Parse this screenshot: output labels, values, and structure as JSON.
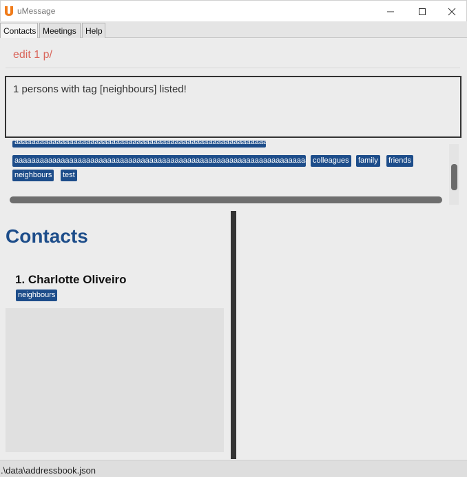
{
  "window": {
    "title": "uMessage",
    "icon": "umessage-logo-icon",
    "accent": "#f07b1a"
  },
  "menu": {
    "items": [
      {
        "label": "Contacts"
      },
      {
        "label": "Meetings"
      },
      {
        "label": "Help"
      }
    ]
  },
  "command": {
    "value": "edit 1 p/",
    "color": "#d9655a"
  },
  "result": {
    "text": "1 persons with tag [neighbours] listed!"
  },
  "tags": {
    "items": [
      {
        "label": "aaaaaaaaaaaaaaaaaaaaaaaaaaaaaaaaaaaaaaaaaaaaaaaaaaaaaaaaaaaaaaaaa"
      },
      {
        "label": "aaaaaaaaaaaaaaaaaaaaaaaaaaaaaaaaaaaaaaaaaaaaaaaaaaaaaaaaaaaaaaaaaaaaaaaaaaa"
      },
      {
        "label": "colleagues"
      },
      {
        "label": "family"
      },
      {
        "label": "friends"
      },
      {
        "label": "neighbours"
      },
      {
        "label": "test"
      }
    ],
    "color": "#1d4d8a"
  },
  "contacts": {
    "title": "Contacts",
    "list": [
      {
        "name": "1.  Charlotte Oliveiro",
        "tags": [
          "neighbours"
        ]
      }
    ]
  },
  "status": {
    "path": ".\\data\\addressbook.json"
  }
}
